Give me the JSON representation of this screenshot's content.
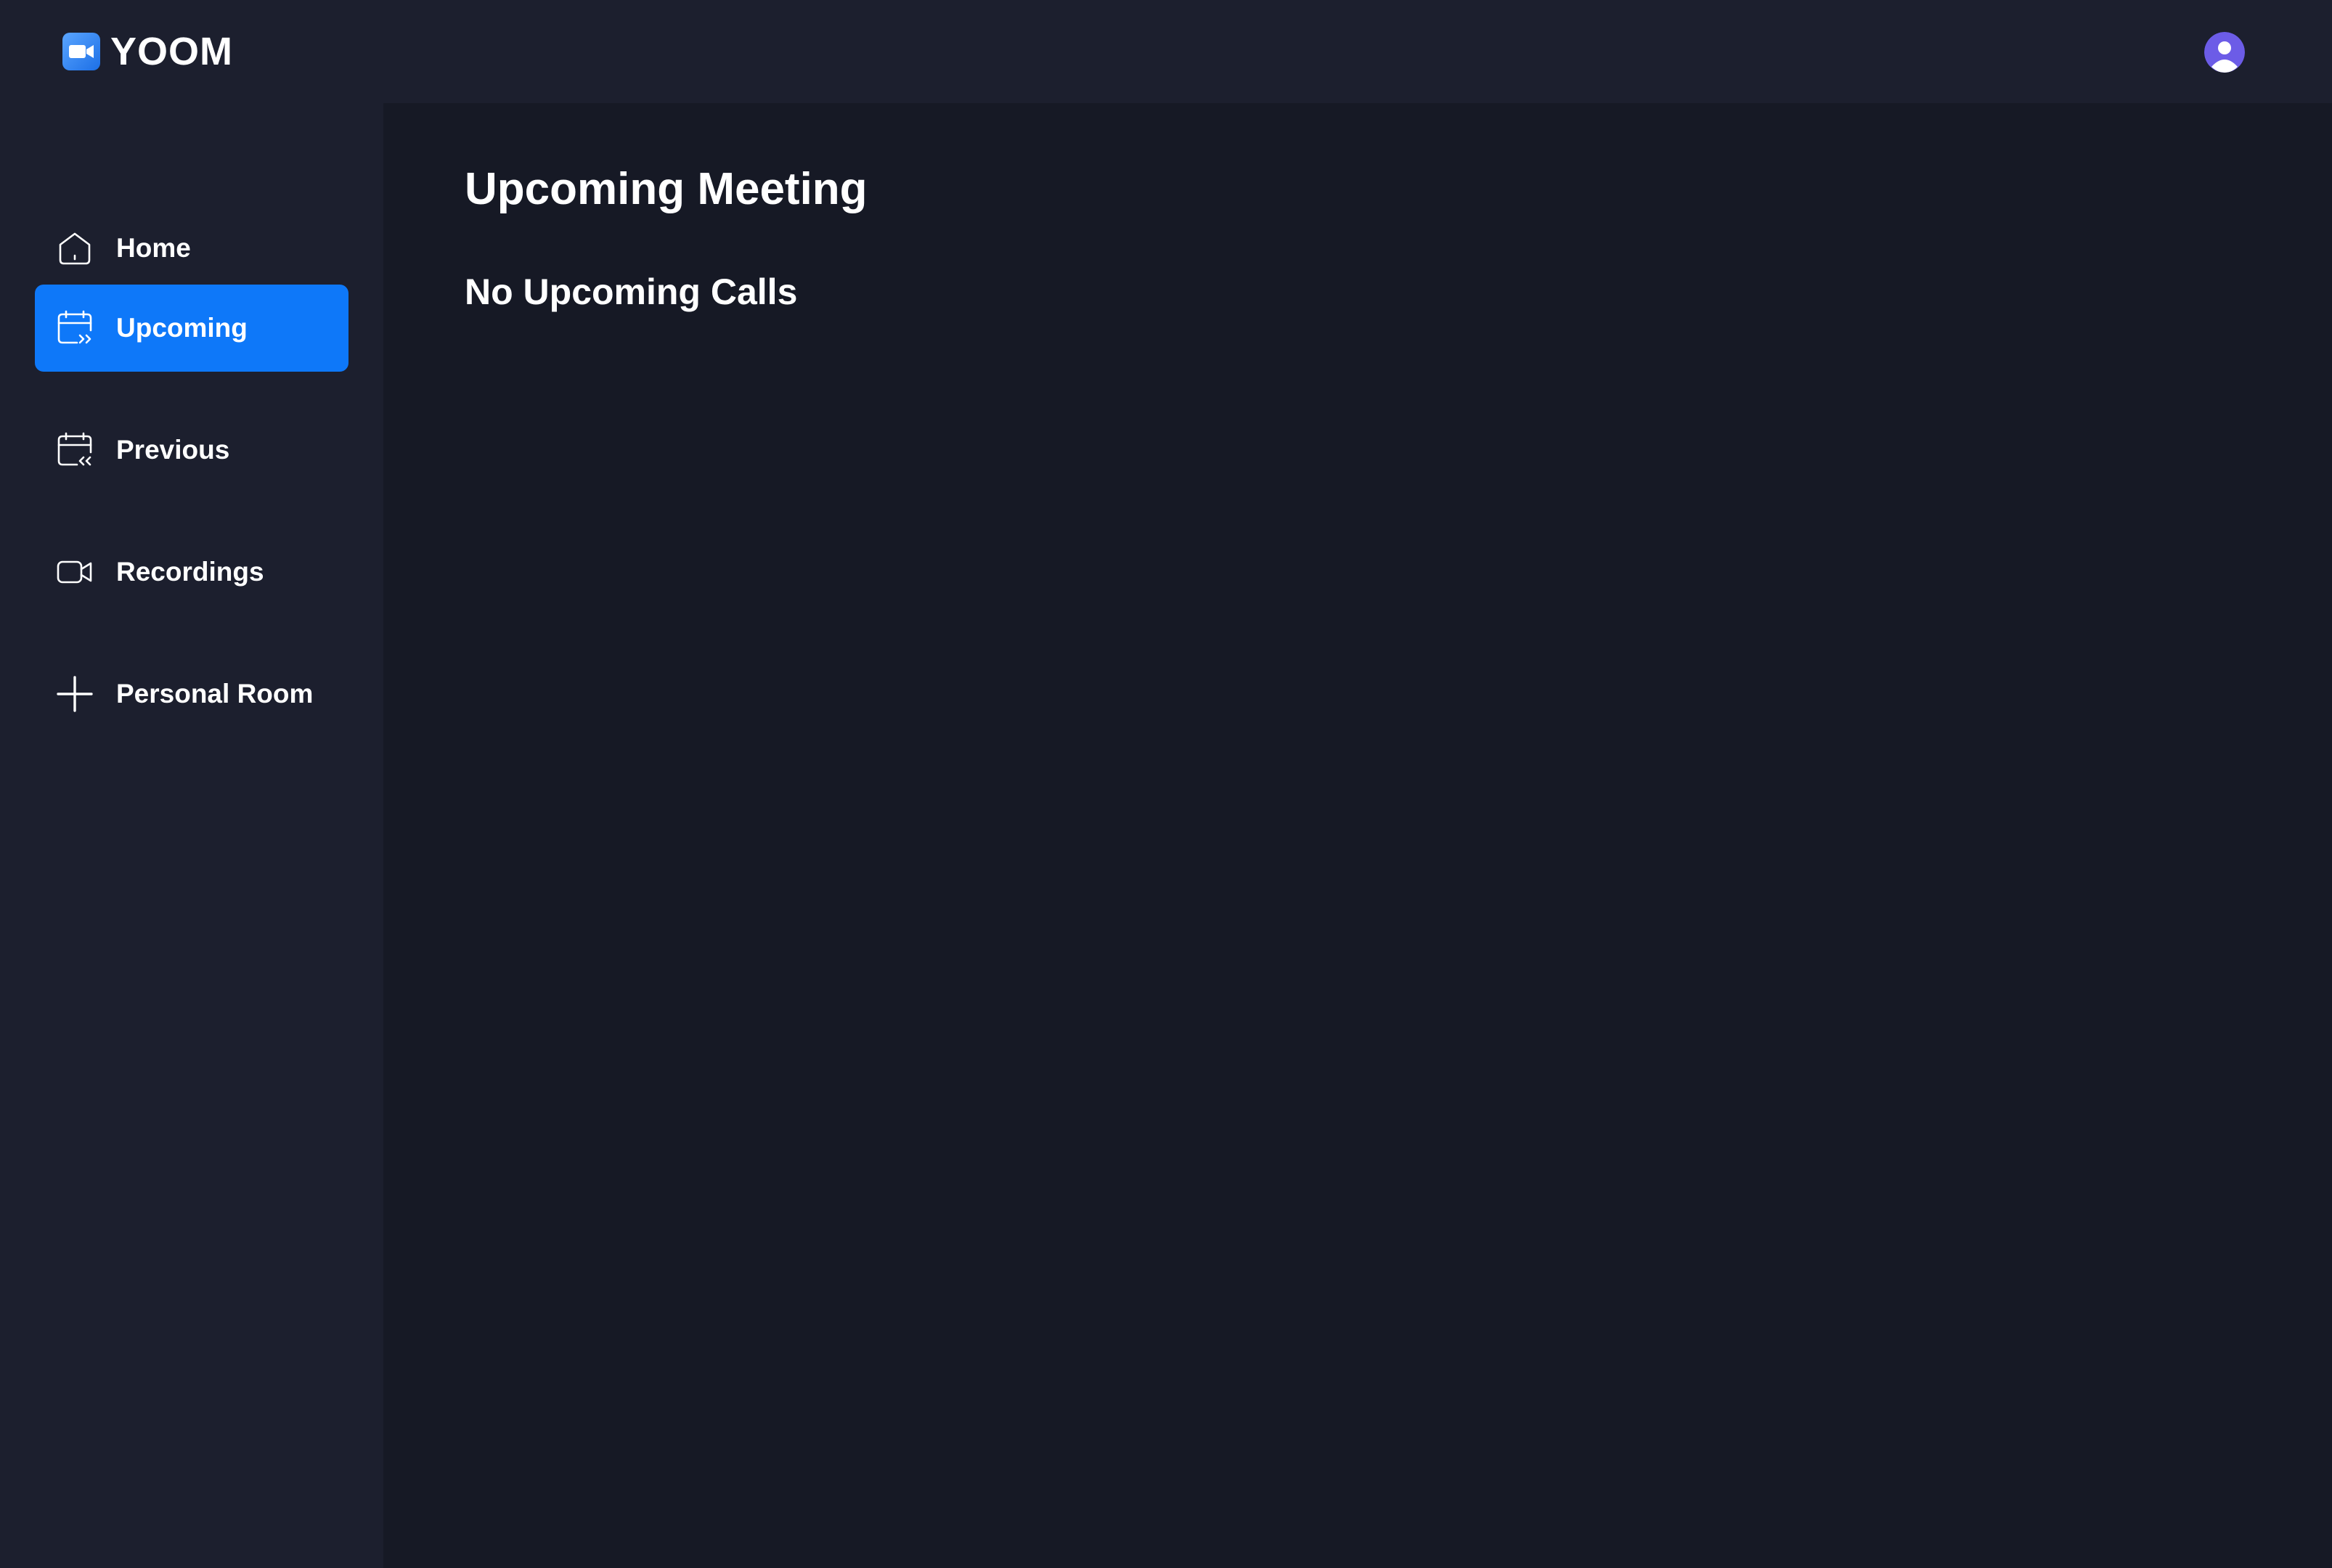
{
  "app": {
    "name": "YOOM",
    "logo_icon": "video-camera-logo-icon",
    "avatar_icon": "user-avatar-icon"
  },
  "sidebar": {
    "items": [
      {
        "label": "Home",
        "icon": "home-icon",
        "active": false
      },
      {
        "label": "Upcoming",
        "icon": "calendar-upcoming-icon",
        "active": true
      },
      {
        "label": "Previous",
        "icon": "calendar-previous-icon",
        "active": false
      },
      {
        "label": "Recordings",
        "icon": "video-icon",
        "active": false
      },
      {
        "label": "Personal Room",
        "icon": "plus-icon",
        "active": false
      }
    ]
  },
  "main": {
    "title": "Upcoming Meeting",
    "empty_message": "No Upcoming Calls"
  },
  "colors": {
    "background": "#161925",
    "panel": "#1c1f2e",
    "accent": "#0e78f9",
    "avatar": "#6c5ce7"
  }
}
